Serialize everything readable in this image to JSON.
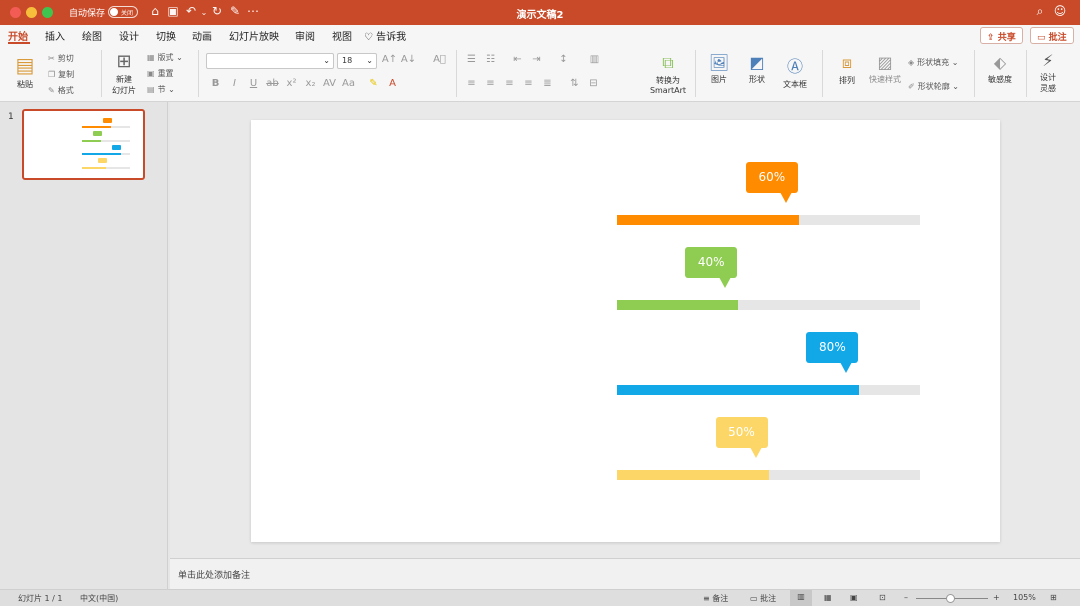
{
  "titlebar": {
    "autosave_label": "自动保存",
    "autosave_state": "关闭",
    "doc_title": "演示文稿2",
    "colors": {
      "bar": "#c94a29",
      "close": "#f25c55",
      "min": "#f6be3b",
      "max": "#3ec44f"
    },
    "icons": [
      "home-icon",
      "save-icon",
      "undo-icon",
      "redo-icon",
      "edit-icon",
      "more-icon"
    ],
    "right_icons": [
      "search-icon",
      "smiley-icon"
    ]
  },
  "tabs": [
    {
      "label": "开始",
      "active": true
    },
    {
      "label": "插入"
    },
    {
      "label": "绘图"
    },
    {
      "label": "设计"
    },
    {
      "label": "切换"
    },
    {
      "label": "动画"
    },
    {
      "label": "幻灯片放映"
    },
    {
      "label": "审阅"
    },
    {
      "label": "视图"
    },
    {
      "label": "告诉我"
    }
  ],
  "share_label": "共享",
  "comment_label": "批注",
  "ribbon": {
    "paste": "粘贴",
    "cut": "剪切",
    "copy": "复制",
    "format": "格式",
    "new_slide_line1": "新建",
    "new_slide_line2": "幻灯片",
    "layout": "版式",
    "reset": "重置",
    "section": "节",
    "font_name": "",
    "font_size": "18",
    "convert_line1": "转换为",
    "convert_line2": "SmartArt",
    "picture": "图片",
    "shape": "形状",
    "textbox": "文本框",
    "arrange": "排列",
    "quick_style": "快速样式",
    "shape_fill": "形状填充",
    "shape_outline": "形状轮廓",
    "sensitivity": "敏感度",
    "designer_line1": "设计",
    "designer_line2": "灵感"
  },
  "slides_panel": {
    "number": "1"
  },
  "slide": {
    "bars": [
      {
        "label": "60%",
        "value": 60,
        "color": "#ff8c00"
      },
      {
        "label": "40%",
        "value": 40,
        "color": "#8fcc52"
      },
      {
        "label": "80%",
        "value": 80,
        "color": "#12a8e8"
      },
      {
        "label": "50%",
        "value": 50,
        "color": "#fcd666"
      }
    ]
  },
  "notes_placeholder": "单击此处添加备注",
  "status": {
    "slide_count": "幻灯片 1 / 1",
    "language": "中文(中国)",
    "notes": "备注",
    "comments": "批注",
    "zoom": "105%"
  }
}
